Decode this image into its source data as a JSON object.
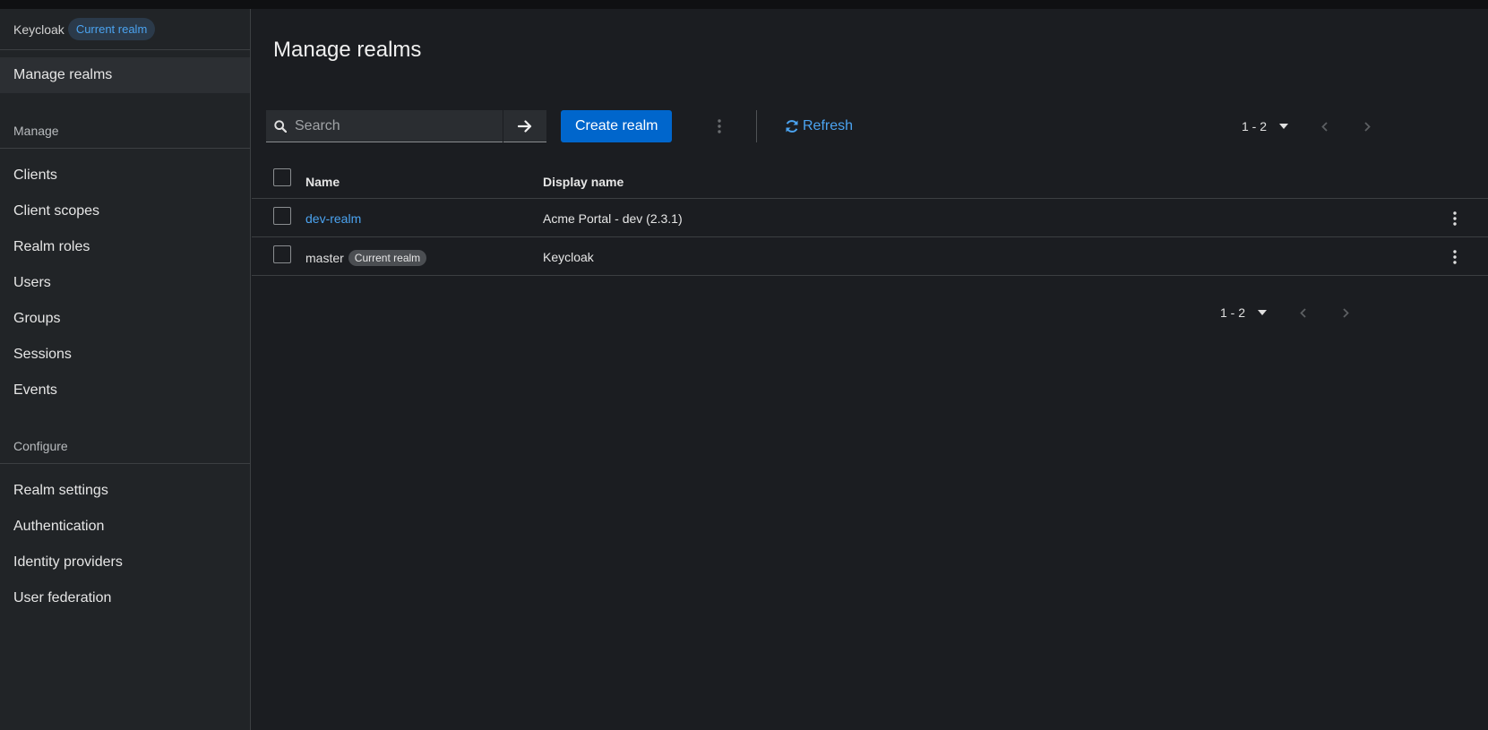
{
  "sidebar": {
    "realm_name": "Keycloak",
    "realm_badge": "Current realm",
    "top_item": "Manage realms",
    "sections": [
      {
        "title": "Manage",
        "items": [
          "Clients",
          "Client scopes",
          "Realm roles",
          "Users",
          "Groups",
          "Sessions",
          "Events"
        ]
      },
      {
        "title": "Configure",
        "items": [
          "Realm settings",
          "Authentication",
          "Identity providers",
          "User federation"
        ]
      }
    ]
  },
  "main": {
    "title": "Manage realms",
    "search": {
      "placeholder": "Search"
    },
    "create_button": "Create realm",
    "refresh_button": "Refresh",
    "pagination_top": "1 - 2",
    "pagination_bottom": "1 - 2"
  },
  "table": {
    "columns": [
      "Name",
      "Display name"
    ],
    "rows": [
      {
        "name": "dev-realm",
        "display_name": "Acme Portal - dev (2.3.1)",
        "badge": ""
      },
      {
        "name": "master",
        "display_name": "Keycloak",
        "badge": "Current realm"
      }
    ]
  },
  "colors": {
    "accent": "#0066cc",
    "link": "#4ba3f0",
    "background": "#1b1d21",
    "sidebar": "#212427"
  }
}
